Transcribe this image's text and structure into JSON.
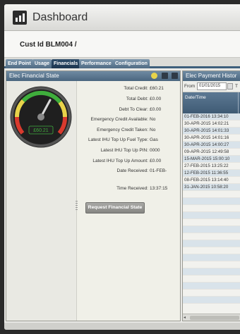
{
  "app": {
    "title": "Dashboard"
  },
  "customer": {
    "label": "Cust Id BLM004 /"
  },
  "tabs": [
    {
      "label": "End Point",
      "active": false
    },
    {
      "label": "Usage",
      "active": false
    },
    {
      "label": "Financials",
      "active": true
    },
    {
      "label": "Performance",
      "active": false
    },
    {
      "label": "Configuration",
      "active": false
    }
  ],
  "financial_state": {
    "title": "Elec Financial State",
    "gauge_reading": "£60.21",
    "fields": [
      {
        "label": "Total Credit:",
        "value": "£60.21"
      },
      {
        "label": "Total Debt:",
        "value": "£0.00"
      },
      {
        "label": "Debt To Clear:",
        "value": "£0.00"
      },
      {
        "label": "Emergency Credit Available:",
        "value": "No"
      },
      {
        "label": "Emergency Credit Taken:",
        "value": "No"
      },
      {
        "label": "Latest IHU Top Up Fuel Type:",
        "value": "Gas"
      },
      {
        "label": "Latest IHU Top Up PIN:",
        "value": "0000"
      },
      {
        "label": "Latest IHU Top Up Amount:",
        "value": "£0.00"
      },
      {
        "label": "Date Received:",
        "value": "01-FEB-"
      },
      {
        "label": "Time Received:",
        "value": "13:37:15"
      }
    ],
    "request_button": "Request Financial State"
  },
  "payment_history": {
    "title": "Elec Payment Histor",
    "from_label": "From",
    "from_value": "01/01/2015",
    "to_label": "T",
    "column_header": "Date/Time",
    "rows": [
      "01-FEB-2016 13:34:10",
      "30-APR-2015 14:02:21",
      "30-APR-2015 14:01:33",
      "30-APR-2015 14:01:16",
      "30-APR-2015 14:00:27",
      "09-APR-2015 12:49:58",
      "15-MAR-2015 15:00:10",
      "27-FEB-2015 13:25:22",
      "12-FEB-2015 11:36:55",
      "08-FEB-2015 13:14:40",
      "31-JAN-2015 10:58:20"
    ]
  },
  "icons": {
    "logo": "bar-chart-icon",
    "help": "help-icon",
    "minimize": "minimize-icon",
    "maximize": "maximize-icon",
    "calendar": "calendar-icon"
  },
  "colors": {
    "accent": "#3d5f7c",
    "gauge_green": "#3fae3c",
    "gauge_yellow": "#e8d34a",
    "gauge_red": "#d83a2e",
    "row_alt": "#d9e3ea"
  }
}
